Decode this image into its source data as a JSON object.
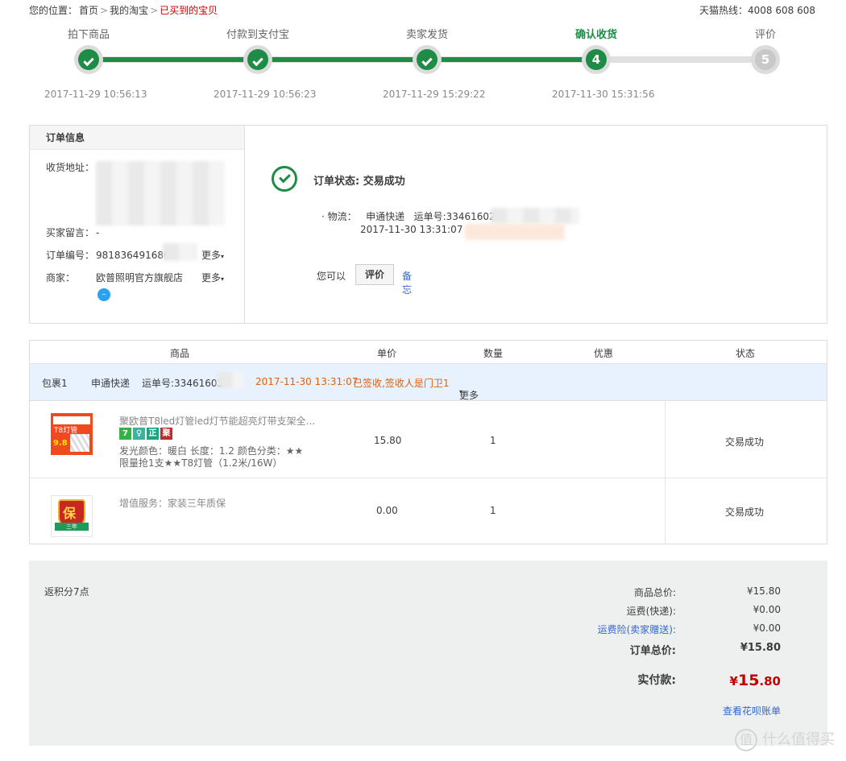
{
  "breadcrumb": {
    "prefix": "您的位置：",
    "home": "首页",
    "my_taobao": "我的淘宝",
    "current": "已买到的宝贝",
    "sep": ">"
  },
  "hotline": "天猫热线：4008 608 608",
  "progress": {
    "steps": [
      {
        "label": "拍下商品",
        "time": "2017-11-29 10:56:13",
        "state": "done"
      },
      {
        "label": "付款到支付宝",
        "time": "2017-11-29 10:56:23",
        "state": "done"
      },
      {
        "label": "卖家发货",
        "time": "2017-11-29 15:29:22",
        "state": "done"
      },
      {
        "label": "确认收货",
        "time": "2017-11-30 15:31:56",
        "state": "current",
        "num": "4"
      },
      {
        "label": "评价",
        "time": "",
        "state": "todo",
        "num": "5"
      }
    ],
    "colors": {
      "done": "#1e8c46",
      "todo": "#c8c8c8"
    }
  },
  "order_info": {
    "title": "订单信息",
    "address_label": "收货地址：",
    "message_label": "买家留言：",
    "message_value": "-",
    "order_no_label": "订单编号：",
    "order_no_value": "9818364916869",
    "merchant_label": "商家：",
    "merchant_value": "欧普照明官方旗舰店",
    "more": "更多"
  },
  "status": {
    "text": "订单状态: 交易成功",
    "logistics_label": "· 物流：",
    "courier": "申通快递",
    "waybill": "运单号:33461602",
    "logistics_time": "2017-11-30 13:31:07",
    "you_can": "您可以",
    "rate_button": "评价",
    "memo": "备忘"
  },
  "table": {
    "headers": [
      "商品",
      "单价",
      "数量",
      "优惠",
      "状态"
    ],
    "package": {
      "name": "包裹1",
      "courier": "申通快递",
      "waybill": "运单号:33461602",
      "time": "2017-11-30 13:31:07",
      "sign": "已签收,签收人是门卫1",
      "more": "更多"
    },
    "rows": [
      {
        "name": "聚欧普T8led灯管led灯节能超亮灯带支架全...",
        "attr1": "发光颜色：暖白 长度：1.2 颜色分类：★★",
        "attr2": "限量抢1支★★T8灯管（1.2米/16W）",
        "price": "15.80",
        "qty": "1",
        "status": "交易成功",
        "thumb_text": "T8灯管",
        "thumb_sub": "9.8",
        "badges": [
          "7",
          "♀",
          "正",
          "聚"
        ]
      },
      {
        "name": "增值服务：家装三年质保",
        "price": "0.00",
        "qty": "1",
        "status": "交易成功",
        "thumb_text": "保",
        "thumb_sub": "三年"
      }
    ]
  },
  "totals": {
    "points": "返积分7点",
    "goods_label": "商品总价:",
    "goods_value": "¥15.80",
    "shipping_label": "运费(快递):",
    "shipping_value": "¥0.00",
    "insurance_label": "运费险(卖家赠送):",
    "insurance_value": "¥0.00",
    "order_total_label": "订单总价:",
    "order_total_value": "¥15.80",
    "paid_label": "实付款:",
    "paid_currency": "¥",
    "paid_int": "15",
    "paid_dec": ".80",
    "huabei": "查看花呗账单"
  },
  "watermark": {
    "icon": "值",
    "text": "什么值得买"
  }
}
